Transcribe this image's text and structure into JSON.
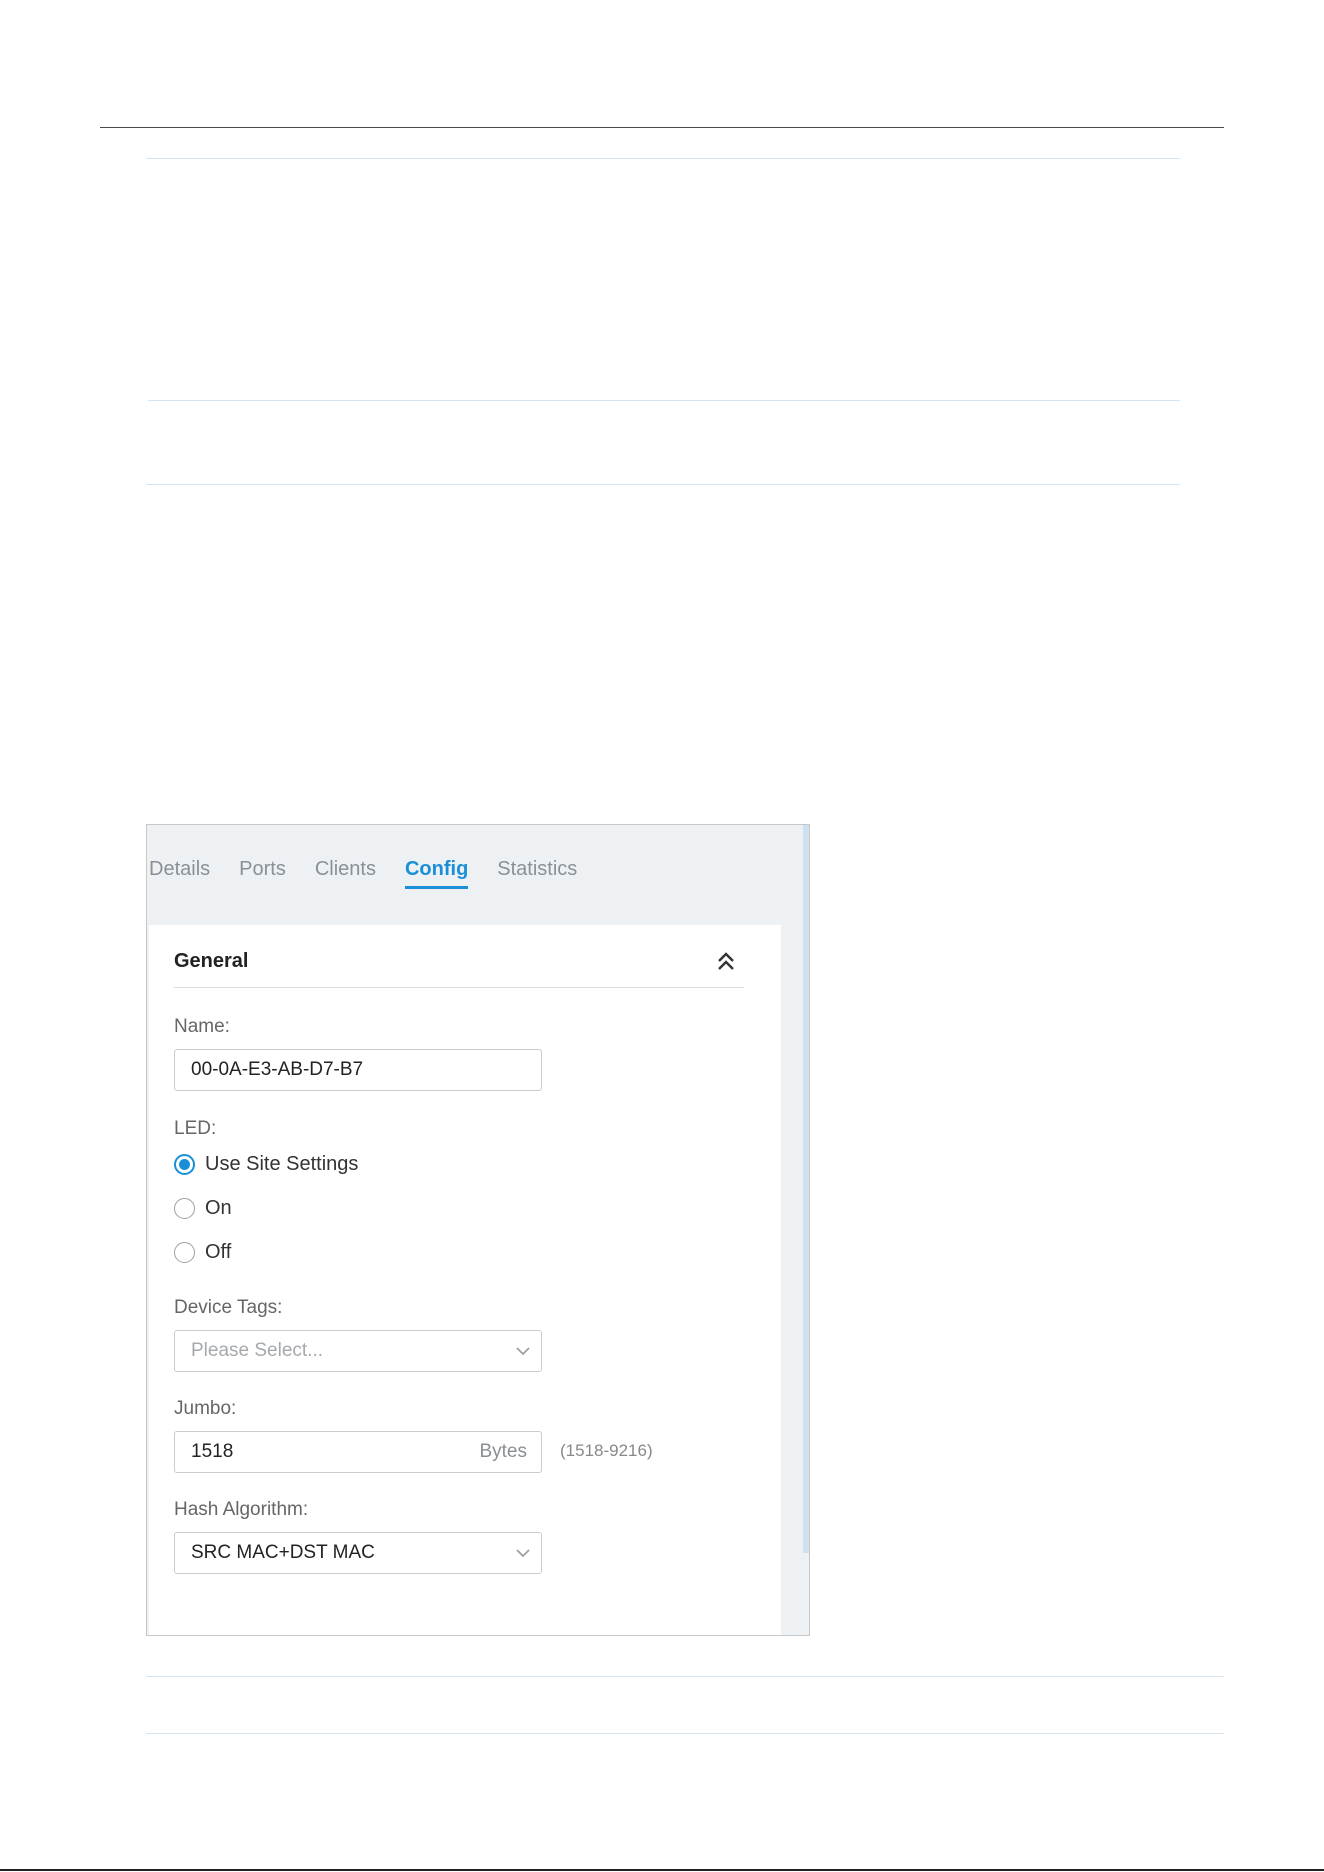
{
  "tabs": [
    "Details",
    "Ports",
    "Clients",
    "Config",
    "Statistics"
  ],
  "active_tab": "Config",
  "section": {
    "title": "General"
  },
  "name_field": {
    "label": "Name:",
    "value": "00-0A-E3-AB-D7-B7"
  },
  "led": {
    "label": "LED:",
    "options": [
      "Use Site Settings",
      "On",
      "Off"
    ],
    "selected": "Use Site Settings"
  },
  "device_tags": {
    "label": "Device Tags:",
    "placeholder": "Please Select..."
  },
  "jumbo": {
    "label": "Jumbo:",
    "value": "1518",
    "unit": "Bytes",
    "range": "(1518-9216)"
  },
  "hash_algorithm": {
    "label": "Hash Algorithm:",
    "value": "SRC MAC+DST MAC"
  },
  "colors": {
    "accent": "#1a8fd8",
    "panel_bg": "#eef1f4"
  },
  "icons": {
    "collapse": "double-chevron-up-icon",
    "dropdown": "chevron-down-icon"
  }
}
